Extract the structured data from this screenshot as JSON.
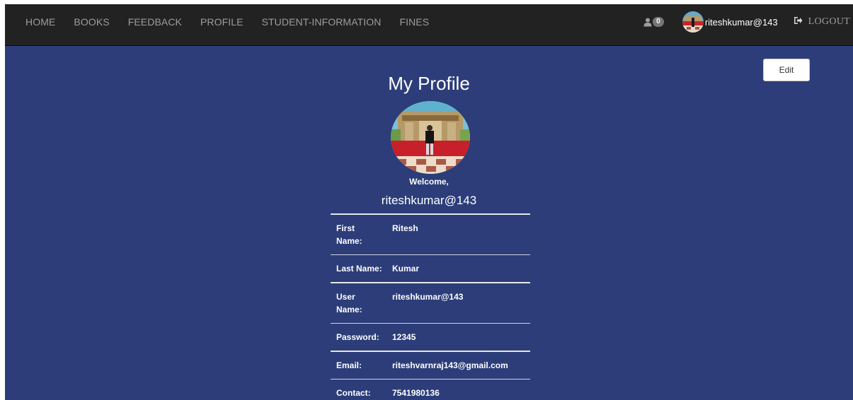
{
  "nav": {
    "items": [
      {
        "label": "HOME"
      },
      {
        "label": "BOOKS"
      },
      {
        "label": "FEEDBACK"
      },
      {
        "label": "PROFILE"
      },
      {
        "label": "STUDENT-INFORMATION"
      },
      {
        "label": "FINES"
      }
    ],
    "notification_count": "0",
    "user_name": "riteshkumar@143",
    "logout_label": "LOGOUT"
  },
  "profile": {
    "title": "My Profile",
    "edit_label": "Edit",
    "welcome": "Welcome,",
    "username": "riteshkumar@143",
    "rows": [
      {
        "label": "First Name:",
        "value": "Ritesh"
      },
      {
        "label": "Last Name:",
        "value": "Kumar"
      },
      {
        "label": "User Name:",
        "value": "riteshkumar@143"
      },
      {
        "label": "Password:",
        "value": "12345"
      },
      {
        "label": "Email:",
        "value": "riteshvarnraj143@gmail.com"
      },
      {
        "label": "Contact:",
        "value": "7541980136"
      }
    ]
  },
  "colors": {
    "navbar_bg": "#222222",
    "page_bg": "#2c3d79",
    "nav_text": "#9d9d9d",
    "text": "#ffffff"
  },
  "icons": {
    "notification": "user-icon",
    "logout": "logout-icon"
  }
}
